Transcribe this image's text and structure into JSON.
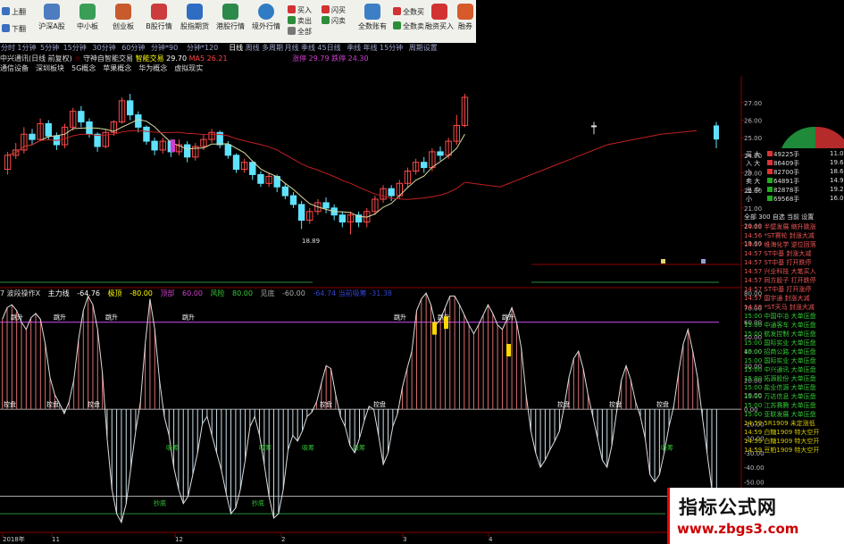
{
  "toolbar": {
    "nav": {
      "up": "上翻",
      "down": "下翻"
    },
    "buttons": [
      {
        "label": "沪深A股",
        "icon": "a-share-icon",
        "color": "#4d7cc0"
      },
      {
        "label": "中小板",
        "icon": "sme-board-icon",
        "color": "#3a9e57"
      },
      {
        "label": "创业板",
        "icon": "gem-board-icon",
        "color": "#c85a2c"
      },
      {
        "label": "B股行情",
        "icon": "b-share-icon",
        "color": "#cc3c3c"
      },
      {
        "label": "股指期货",
        "icon": "futures-icon",
        "color": "#2f6dc2"
      },
      {
        "label": "港股行情",
        "icon": "hk-stock-icon",
        "color": "#2b8a4a"
      },
      {
        "label": "境外行情",
        "icon": "global-icon",
        "color": "#2f7cc2"
      }
    ],
    "trade": [
      {
        "label": "买入",
        "color": "#d23232"
      },
      {
        "label": "卖出",
        "color": "#2c8d3a"
      },
      {
        "label": "闪买",
        "color": "#d23232"
      },
      {
        "label": "闪卖",
        "color": "#2c8d3a"
      }
    ],
    "all_label": "全部",
    "all_account": "全数账有",
    "full_buy": "全数买",
    "full_sell": "全数卖",
    "margin_buy": "融资买入",
    "margin_sell": "融券"
  },
  "periods": [
    "分时",
    "1分钟",
    "5分钟",
    "15分钟",
    "30分钟",
    "60分钟",
    "分钟*90",
    "分钟*120",
    "日线",
    "周线",
    "多周期",
    "月线",
    "季线",
    "45日线",
    "季线",
    "年线",
    "15分钟",
    "周期设置"
  ],
  "info": {
    "stock": "中兴通讯(日线 前复权)",
    "star": "守神自智能交易",
    "strategy": "智能交易",
    "price_label": "29.70",
    "ma_label": "MA5",
    "ma_value": "26.21",
    "extra1": "涨停",
    "extra2": "29.79",
    "extra3": "跌停",
    "extra4": "24.30"
  },
  "tabs": [
    "通信设备",
    "深圳板块",
    "5G概念",
    "苹果概念",
    "华为概念",
    "虚拟现实"
  ],
  "indicator": {
    "name": "7 波段操作X",
    "main_label": "主力线",
    "main_value": "-64.76",
    "top_label": "极顶",
    "top_value": "-80.00",
    "mid_label": "顶部",
    "mid_value": "60.00",
    "risk_label": "风险",
    "risk_value": "80.00",
    "bot_label": "见底",
    "bot_value": "-60.00",
    "extra": "-64.74 当前吸筹 -31.38"
  },
  "signals": {
    "jump": "跳升",
    "control": "控盘",
    "inflow": "吸筹",
    "bottom": "抄底"
  },
  "price_axis": [
    "27.00",
    "26.00",
    "25.00",
    "24.00",
    "23.00",
    "22.00",
    "21.00",
    "20.00",
    "19.00"
  ],
  "low_price": "18.89",
  "ind_axis": [
    "80.00",
    "70.00",
    "60.00",
    "50.00",
    "40.00",
    "30.00",
    "20.00",
    "10.00",
    "0.00",
    "-10.00",
    "-20.00",
    "-30.00",
    "-40.00",
    "-50.00",
    "-60.00",
    "-70.00"
  ],
  "date_axis": [
    "2018年",
    "11",
    "12",
    "2",
    "3",
    "4"
  ],
  "right_panel": {
    "rows": [
      {
        "k": "大",
        "v": "49225手",
        "p": "11.09"
      },
      {
        "k": "大",
        "v": "86409手",
        "p": "19.68"
      },
      {
        "k": "小",
        "v": "82700手",
        "p": "18.67"
      },
      {
        "k": "大",
        "v": "64891手",
        "p": "14.93"
      },
      {
        "k": "中",
        "v": "82878手",
        "p": "19.27"
      },
      {
        "k": "小",
        "v": "69568手",
        "p": "16.05"
      }
    ],
    "side": [
      "买",
      "入",
      "卖",
      "出"
    ],
    "footer": "全部 300 自选 当前 设置",
    "ticker": [
      "14:55 半壁发展  缩升跳涨",
      "14:56 *ST赛轮  封涨大减",
      "14:57 维海化学  逆位回落",
      "14:57 ST中基  封涨大减",
      "14:57 ST中基  打开跌停",
      "14:57 兴业科技  大笔买入",
      "14:57 同方股子  打开跌停",
      "14:57 ST中基  打开涨停",
      "14:57 国宇通  封涨大减",
      "14:59 *ST天马  封涨大减",
      "15:00 中国中冶  大单压盘",
      "15:00 中通客车  大单压盘",
      "15:00 航发控制  大单压盘",
      "15:00 国际实业  大单压盘",
      "15:00 招商公路  大单压盘",
      "15:00 国际实业  大单压盘",
      "15:00 中兴通讯  大单压盘",
      "15:00 拓源股份  大单压盘",
      "15:00 盐业信源  大单压盘",
      "15:00 万达信息  大单压盘",
      "15:00 江苏赛腾  大单压盘",
      "15:00 亚联发展  大单压盘",
      "14:59 5R1909  未定涨低",
      "14:59 白糖1909  特大空开",
      "14:59 白糖1909  特大空开",
      "14:59 豆粕1909  特大空开"
    ]
  },
  "watermark": {
    "title": "指标公式网",
    "url": "www.zbgs3.com"
  },
  "colors": {
    "up": "#ff4a4a",
    "down": "#5fe2ff",
    "ma": "#c02020",
    "ma_short": "#d8d8a0",
    "grid": "#8b0000",
    "ind_up": "#d86f6f",
    "ind_down": "#c8dde8",
    "purple": "#a23cc8",
    "green_line": "#2a8a3a"
  },
  "chart_data": {
    "type": "candlestick+indicator",
    "price_ylim": [
      18.5,
      27.5
    ],
    "candles": [
      {
        "o": 23.2,
        "c": 24.0,
        "h": 24.2,
        "l": 22.9
      },
      {
        "o": 24.0,
        "c": 24.3,
        "h": 24.7,
        "l": 23.8
      },
      {
        "o": 24.3,
        "c": 25.2,
        "h": 25.6,
        "l": 24.1
      },
      {
        "o": 25.2,
        "c": 24.9,
        "h": 25.5,
        "l": 24.6
      },
      {
        "o": 24.9,
        "c": 25.8,
        "h": 26.1,
        "l": 24.8
      },
      {
        "o": 25.8,
        "c": 25.1,
        "h": 26.0,
        "l": 24.9
      },
      {
        "o": 25.1,
        "c": 24.6,
        "h": 25.3,
        "l": 24.3
      },
      {
        "o": 24.6,
        "c": 25.6,
        "h": 25.8,
        "l": 24.4
      },
      {
        "o": 25.6,
        "c": 26.5,
        "h": 26.7,
        "l": 25.4
      },
      {
        "o": 26.5,
        "c": 25.9,
        "h": 26.8,
        "l": 25.6
      },
      {
        "o": 25.9,
        "c": 25.2,
        "h": 26.1,
        "l": 25.0
      },
      {
        "o": 25.2,
        "c": 24.5,
        "h": 25.3,
        "l": 24.2
      },
      {
        "o": 24.5,
        "c": 25.3,
        "h": 25.5,
        "l": 24.4
      },
      {
        "o": 25.3,
        "c": 25.9,
        "h": 26.0,
        "l": 25.1
      },
      {
        "o": 25.9,
        "c": 27.1,
        "h": 27.3,
        "l": 25.8
      },
      {
        "o": 27.1,
        "c": 26.3,
        "h": 27.5,
        "l": 26.0
      },
      {
        "o": 26.3,
        "c": 25.6,
        "h": 26.5,
        "l": 25.3
      },
      {
        "o": 25.6,
        "c": 24.8,
        "h": 25.7,
        "l": 24.6
      },
      {
        "o": 24.8,
        "c": 24.3,
        "h": 25.0,
        "l": 24.0
      },
      {
        "o": 24.3,
        "c": 24.8,
        "h": 25.0,
        "l": 24.1
      },
      {
        "o": 24.8,
        "c": 24.2,
        "h": 24.9,
        "l": 23.9
      },
      {
        "o": 24.2,
        "c": 24.6,
        "h": 24.9,
        "l": 24.0
      },
      {
        "o": 24.6,
        "c": 23.9,
        "h": 24.8,
        "l": 23.6
      },
      {
        "o": 23.9,
        "c": 24.5,
        "h": 24.7,
        "l": 23.7
      },
      {
        "o": 24.5,
        "c": 24.9,
        "h": 25.2,
        "l": 24.3
      },
      {
        "o": 24.9,
        "c": 25.3,
        "h": 25.5,
        "l": 24.7
      },
      {
        "o": 25.3,
        "c": 24.6,
        "h": 25.4,
        "l": 24.4
      },
      {
        "o": 24.6,
        "c": 24.0,
        "h": 24.8,
        "l": 23.8
      },
      {
        "o": 24.0,
        "c": 23.2,
        "h": 24.1,
        "l": 23.0
      },
      {
        "o": 23.2,
        "c": 23.6,
        "h": 23.8,
        "l": 23.0
      },
      {
        "o": 23.6,
        "c": 22.9,
        "h": 23.7,
        "l": 22.6
      },
      {
        "o": 22.9,
        "c": 22.4,
        "h": 23.1,
        "l": 22.2
      },
      {
        "o": 22.4,
        "c": 22.8,
        "h": 23.0,
        "l": 22.2
      },
      {
        "o": 22.8,
        "c": 22.2,
        "h": 22.9,
        "l": 21.9
      },
      {
        "o": 22.2,
        "c": 21.7,
        "h": 22.4,
        "l": 21.5
      },
      {
        "o": 21.7,
        "c": 21.2,
        "h": 21.9,
        "l": 21.0
      },
      {
        "o": 21.2,
        "c": 20.3,
        "h": 21.4,
        "l": 19.8
      },
      {
        "o": 20.3,
        "c": 20.8,
        "h": 21.0,
        "l": 20.1
      },
      {
        "o": 20.8,
        "c": 21.3,
        "h": 21.5,
        "l": 20.6
      },
      {
        "o": 21.3,
        "c": 21.0,
        "h": 21.6,
        "l": 20.7
      },
      {
        "o": 21.0,
        "c": 20.6,
        "h": 21.2,
        "l": 20.3
      },
      {
        "o": 20.6,
        "c": 20.2,
        "h": 20.8,
        "l": 19.9
      },
      {
        "o": 20.2,
        "c": 20.6,
        "h": 20.8,
        "l": 19.5
      },
      {
        "o": 20.6,
        "c": 20.2,
        "h": 20.8,
        "l": 19.9
      },
      {
        "o": 20.2,
        "c": 20.8,
        "h": 21.0,
        "l": 19.9
      },
      {
        "o": 20.8,
        "c": 21.5,
        "h": 21.7,
        "l": 20.6
      },
      {
        "o": 21.5,
        "c": 22.1,
        "h": 22.3,
        "l": 21.3
      },
      {
        "o": 22.1,
        "c": 21.7,
        "h": 22.3,
        "l": 21.4
      },
      {
        "o": 21.7,
        "c": 22.4,
        "h": 22.6,
        "l": 21.5
      },
      {
        "o": 22.4,
        "c": 23.1,
        "h": 23.3,
        "l": 22.2
      },
      {
        "o": 23.1,
        "c": 23.6,
        "h": 23.8,
        "l": 22.9
      },
      {
        "o": 23.6,
        "c": 23.3,
        "h": 23.9,
        "l": 23.0
      },
      {
        "o": 23.3,
        "c": 24.2,
        "h": 24.4,
        "l": 23.1
      },
      {
        "o": 24.2,
        "c": 24.0,
        "h": 24.5,
        "l": 23.7
      },
      {
        "o": 24.0,
        "c": 24.8,
        "h": 25.0,
        "l": 23.8
      },
      {
        "o": 24.8,
        "c": 25.7,
        "h": 26.3,
        "l": 24.6
      },
      {
        "o": 25.7,
        "c": 27.3,
        "h": 27.5,
        "l": 25.6
      }
    ],
    "indicator_ylim": [
      -75,
      85
    ],
    "indicator": [
      62,
      70,
      72,
      68,
      60,
      55,
      63,
      66,
      62,
      45,
      22,
      10,
      4,
      -3,
      5,
      20,
      48,
      68,
      78,
      72,
      55,
      25,
      -20,
      -55,
      -72,
      -78,
      -65,
      -40,
      -15,
      5,
      45,
      76,
      55,
      20,
      -5,
      -18,
      -40,
      -55,
      -65,
      -60,
      -45,
      -30,
      -10,
      -5,
      -18,
      -30,
      -42,
      -58,
      -72,
      -68,
      -55,
      -35,
      -12,
      -5,
      -18,
      -38,
      -60,
      -75,
      -72,
      -55,
      -28,
      -18,
      -22,
      -15,
      -5,
      -2,
      5,
      18,
      30,
      28,
      10,
      -5,
      -12,
      -25,
      -30,
      -20,
      -8,
      2,
      0,
      -18,
      -38,
      -30,
      -12,
      -3,
      15,
      28,
      40,
      68,
      76,
      80,
      72,
      58,
      62,
      70,
      78,
      78,
      72,
      65,
      58,
      52,
      58,
      65,
      72,
      66,
      58,
      55,
      62,
      70,
      60,
      42,
      10,
      -15,
      -30,
      -40,
      -35,
      -28,
      -22,
      -15,
      2,
      22,
      35,
      40,
      28,
      10,
      -5,
      -20,
      -35,
      -40,
      -25,
      -2,
      20,
      30,
      20,
      5,
      -5,
      -20,
      -45,
      -50,
      -45,
      -30,
      -12,
      2,
      25,
      45,
      55,
      40,
      22,
      -5,
      -30,
      -55,
      -65
    ]
  }
}
